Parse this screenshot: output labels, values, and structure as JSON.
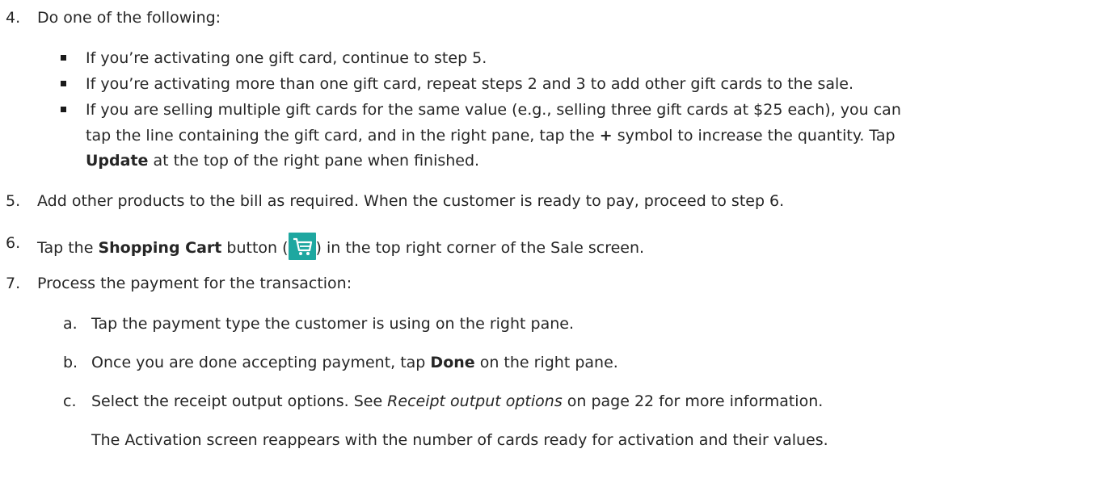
{
  "step4": {
    "number": "4.",
    "text": "Do one of the following:",
    "bullets": [
      {
        "text": "If you’re activating one gift card, continue to step 5."
      },
      {
        "text": "If you’re activating more than one gift card, repeat steps 2 and 3 to add other gift cards to the sale."
      },
      {
        "line1": "If you are selling multiple gift cards for the same value (e.g., selling three gift cards at $25 each), you can",
        "line2_pre": "tap the line containing the gift card, and in the right pane, tap the ",
        "line2_bold": "+",
        "line2_post": " symbol to increase the quantity. Tap",
        "line3_bold": "Update",
        "line3_post": " at the top of the right pane when finished."
      }
    ]
  },
  "step5": {
    "number": "5.",
    "text": "Add other products to the bill as required. When the customer is ready to pay, proceed to step 6."
  },
  "step6": {
    "number": "6.",
    "pre": "Tap the ",
    "bold": "Shopping Cart",
    "mid": " button (",
    "icon": "shopping-cart-icon",
    "post": ") in the top right corner of the Sale screen.",
    "icon_color": "#1ea7a0"
  },
  "step7": {
    "number": "7.",
    "text": "Process the payment for the transaction:",
    "substeps": [
      {
        "letter": "a.",
        "text": "Tap the payment type the customer is using on the right pane."
      },
      {
        "letter": "b.",
        "pre": "Once you are done accepting payment, tap ",
        "bold": "Done",
        "post": " on the right pane."
      },
      {
        "letter": "c.",
        "pre": "Select the receipt output options. See ",
        "italic": "Receipt output options",
        "post": " on page 22 for more information."
      }
    ],
    "note": "The Activation screen reappears with the number of cards ready for activation and their values."
  }
}
